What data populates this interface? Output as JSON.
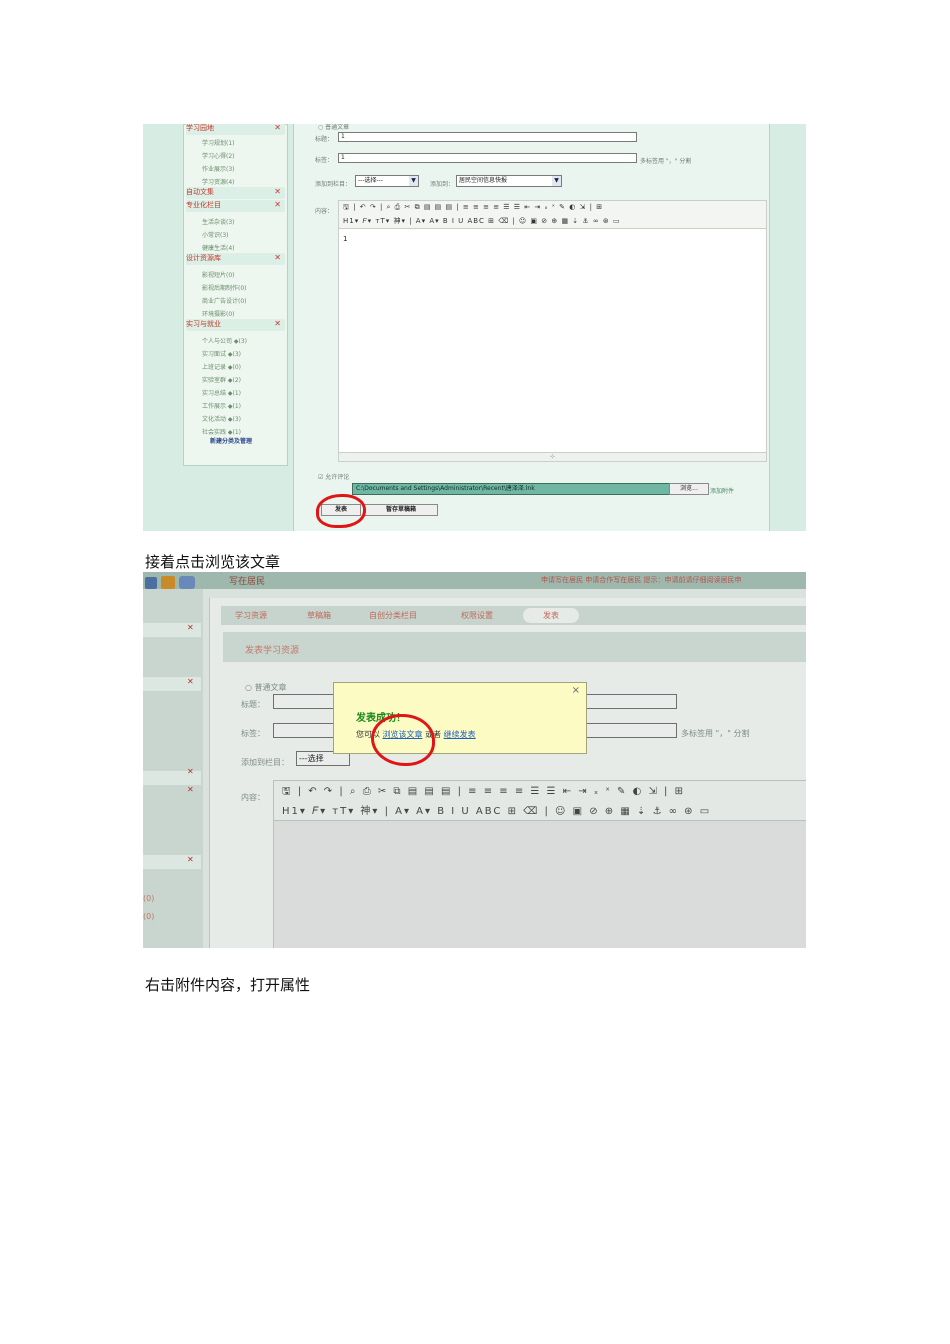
{
  "captions": {
    "first": "接着点击浏览该文章",
    "second": "右击附件内容，打开属性"
  },
  "shot1": {
    "categories": [
      {
        "label": "学习园地",
        "items": [
          "学习规划(1)",
          "学习心得(2)",
          "作业展示(3)",
          "学习资源(4)"
        ]
      },
      {
        "label": "自动文集",
        "items": []
      },
      {
        "label": "专业化栏目",
        "items": [
          "生活杂谈(3)",
          "小常识(3)",
          "健康生活(4)"
        ]
      },
      {
        "label": "设计资源库",
        "items": [
          "影视短片(0)",
          "影视后期制作(0)",
          "商业广告设计(0)",
          "环境摄影(0)"
        ]
      },
      {
        "label": "实习与就业",
        "items": [
          "个人与公司 ◆(3)",
          "实习面试 ◆(3)",
          "上班记录 ◆(0)",
          "实验室群 ◆(2)",
          "实习总结 ◆(1)",
          "工作展示 ◆(1)",
          "文化活动 ◆(3)",
          "社会实践 ◆(1)"
        ]
      }
    ],
    "manage_link": "新建分类及管理",
    "form": {
      "radio_label": "普通文章",
      "title_label": "标题：",
      "title_value": "1",
      "tag_label": "标签：",
      "tag_value": "1",
      "tag_hint": "多标签用 \"，\" 分割",
      "column_label": "添加到栏目：",
      "column_value": "---选择---",
      "column_arrow": "▼",
      "addto_label": "添加到：",
      "addto_value": "居民空间信息快报",
      "addto_arrow": "▼",
      "content_label": "内容：",
      "toolbar_row1": "🖫 | ↶ ↷ | ⌕ ⎙ ✂ ⧉ ▤ ▤ ▤ | ≡ ≡ ≡ ≡ ☰ ☰ ⇤ ⇥ ₓ ˣ ✎ ◐ ⇲ | ⊞",
      "toolbar_row2": "H1▾ 𝐹▾ тT▾ 神▾ | A▾ A▾ B I U ABC ⊞ ⌫ | ☺ ▣ ⊘ ⊕ ▦ ⇣ ⚓ ∞ ⊛ ▭",
      "editor_text": "1",
      "resize_glyph": "⊹",
      "allow_comment": "允许评论",
      "attachment_path": "C:\\Documents and Settings\\Administrator\\Recent\\唐泽泽.lnk",
      "browse_button": "浏览...",
      "add_attachment": "添加附件",
      "publish_button": "发表",
      "save_draft_button": "暂存草稿箱"
    }
  },
  "shot2": {
    "topbar_title": "写在居民",
    "topbar_right": "申请写在居民  申请合作写在居民  提示：申请前请仔细阅读居民申",
    "tabs": [
      "学习资源",
      "草稿箱",
      "自创分类栏目",
      "权限设置",
      "发表"
    ],
    "section_title": "发表学习资源",
    "radio_label": "普通文章",
    "title_label": "标题：",
    "tag_label": "标签：",
    "tag_hint": "多标签用 \"，\" 分割",
    "column_label": "添加到栏目：",
    "column_value": "---选择",
    "content_label": "内容：",
    "toolbar_row1": "🖫 | ↶ ↷ | ⌕ ⎙ ✂ ⧉ ▤ ▤ ▤ | ≡ ≡ ≡ ≡ ☰ ☰ ⇤ ⇥ ₓ ˣ ✎ ◐ ⇲ | ⊞",
    "toolbar_row2": "H1▾ 𝐹▾ тT▾ 神▾ | A▾ A▾ B I U ABC ⊞ ⌫ | ☺ ▣ ⊘ ⊕ ▦ ⇣ ⚓ ∞ ⊛ ▭",
    "left_counts": [
      "(0)",
      "(0)"
    ],
    "close_glyph": "✕",
    "dialog": {
      "title": "发表成功！",
      "prefix": "您可以",
      "link_view": "浏览该文章",
      "middle": "或者",
      "link_continue": "继续发表",
      "close": "×"
    }
  }
}
